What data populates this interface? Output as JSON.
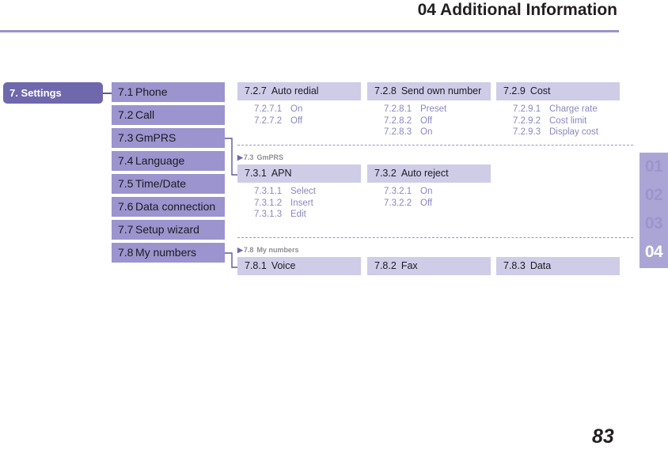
{
  "header": {
    "title": "04 Additional Information"
  },
  "chapter_tabs": {
    "items": [
      {
        "label": "01",
        "active": false
      },
      {
        "label": "02",
        "active": false
      },
      {
        "label": "03",
        "active": false
      },
      {
        "label": "04",
        "active": true
      }
    ]
  },
  "page_number": "83",
  "root": {
    "label": "7. Settings"
  },
  "menu": {
    "items": [
      {
        "num": "7.1",
        "label": "Phone"
      },
      {
        "num": "7.2",
        "label": "Call"
      },
      {
        "num": "7.3",
        "label": "GmPRS"
      },
      {
        "num": "7.4",
        "label": "Language"
      },
      {
        "num": "7.5",
        "label": "Time/Date"
      },
      {
        "num": "7.6",
        "label": "Data connection"
      },
      {
        "num": "7.7",
        "label": "Setup wizard"
      },
      {
        "num": "7.8",
        "label": "My numbers"
      }
    ]
  },
  "groups": [
    {
      "tag_num": "",
      "tag_label": "",
      "nodes": [
        {
          "num": "7.2.7",
          "label": "Auto redial",
          "children": [
            {
              "num": "7.2.7.1",
              "label": "On"
            },
            {
              "num": "7.2.7.2",
              "label": "Off"
            }
          ]
        },
        {
          "num": "7.2.8",
          "label": "Send own number",
          "children": [
            {
              "num": "7.2.8.1",
              "label": "Preset"
            },
            {
              "num": "7.2.8.2",
              "label": "Off"
            },
            {
              "num": "7.2.8.3",
              "label": "On"
            }
          ]
        },
        {
          "num": "7.2.9",
          "label": "Cost",
          "children": [
            {
              "num": "7.2.9.1",
              "label": "Charge rate"
            },
            {
              "num": "7.2.9.2",
              "label": "Cost limit"
            },
            {
              "num": "7.2.9.3",
              "label": "Display cost"
            }
          ]
        }
      ]
    },
    {
      "tag_num": "7.3",
      "tag_label": "GmPRS",
      "nodes": [
        {
          "num": "7.3.1",
          "label": "APN",
          "children": [
            {
              "num": "7.3.1.1",
              "label": "Select"
            },
            {
              "num": "7.3.1.2",
              "label": "Insert"
            },
            {
              "num": "7.3.1.3",
              "label": "Edit"
            }
          ]
        },
        {
          "num": "7.3.2",
          "label": "Auto reject",
          "children": [
            {
              "num": "7.3.2.1",
              "label": "On"
            },
            {
              "num": "7.3.2.2",
              "label": "Off"
            }
          ]
        }
      ]
    },
    {
      "tag_num": "7.8",
      "tag_label": "My numbers",
      "nodes": [
        {
          "num": "7.8.1",
          "label": "Voice",
          "children": []
        },
        {
          "num": "7.8.2",
          "label": "Fax",
          "children": []
        },
        {
          "num": "7.8.3",
          "label": "Data",
          "children": []
        }
      ]
    }
  ],
  "colors": {
    "rule": "#9a93cb",
    "root_box": "#6f68ac",
    "menu_box": "#9b94ce",
    "node_header": "#cfcce8",
    "child_text": "#8b86c0",
    "tab_bar": "#aba5d6",
    "tab_inactive_text": "#9c95cb",
    "tab_active_text": "#ffffff"
  },
  "icons": {
    "group_marker": "▶"
  }
}
